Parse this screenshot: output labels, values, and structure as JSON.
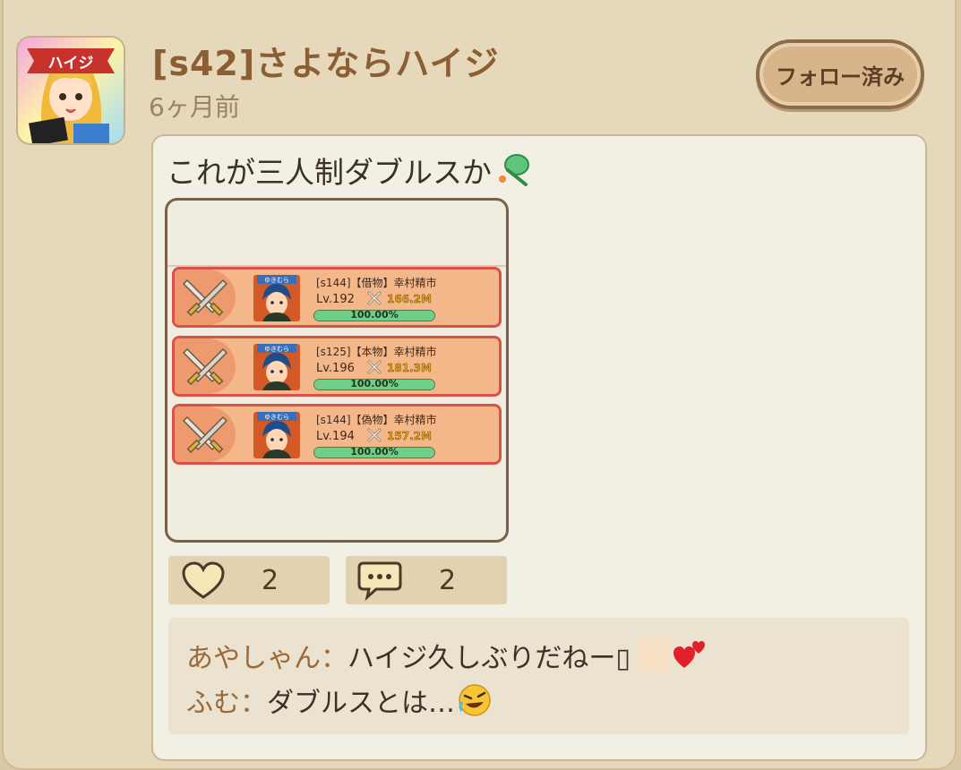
{
  "post": {
    "author": "[s42]さよならハイジ",
    "time": "6ヶ月前",
    "follow_label": "フォロー済み",
    "avatar_banner": "ハイジ",
    "text": "これが三人制ダブルスか",
    "text_emoji": "tennis-racket-icon",
    "likes": "2",
    "comments_count": "2"
  },
  "screenshot": {
    "rows": [
      {
        "name": "[s144]【借物】幸村精市",
        "level": "Lv.192",
        "power": "166.2M",
        "hp": "100.00%",
        "hp_fraction": 1.0,
        "badge": "ゆきむら"
      },
      {
        "name": "[s125]【本物】幸村精市",
        "level": "Lv.196",
        "power": "181.3M",
        "hp": "100.00%",
        "hp_fraction": 1.0,
        "badge": "ゆきむら"
      },
      {
        "name": "[s144]【偽物】幸村精市",
        "level": "Lv.194",
        "power": "157.2M",
        "hp": "100.00%",
        "hp_fraction": 1.0,
        "badge": "ゆきむら"
      }
    ]
  },
  "comments": [
    {
      "author": "あやしゃん",
      "sep": "：",
      "text": "ハイジ久しぶりだねー▯"
    },
    {
      "author": "ふむ",
      "sep": "：",
      "text": "ダブルスとは…"
    }
  ],
  "colors": {
    "accent_name": "#8b5e34",
    "row_border": "#d9524a",
    "hp_fill": "#6fcf89"
  }
}
